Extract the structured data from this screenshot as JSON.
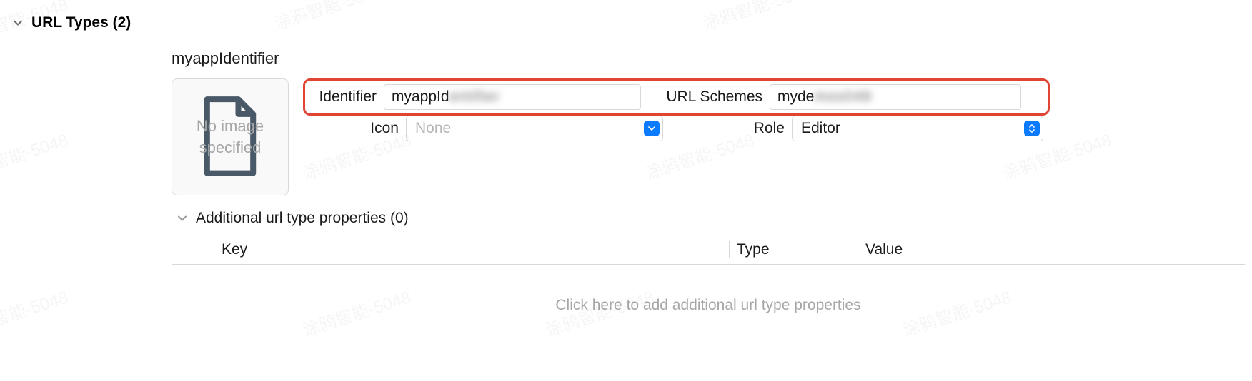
{
  "section": {
    "title": "URL Types (2)"
  },
  "urlType": {
    "name": "myappIdentifier",
    "imageWell": "No image specified",
    "fields": {
      "identifier_label": "Identifier",
      "identifier_visible": "myappId",
      "identifier_hidden": "entifier",
      "urlschemes_label": "URL Schemes",
      "urlschemes_visible": "myde",
      "urlschemes_hidden": "mos048",
      "icon_label": "Icon",
      "icon_placeholder": "None",
      "role_label": "Role",
      "role_value": "Editor"
    }
  },
  "additional": {
    "title": "Additional url type properties (0)",
    "columns": {
      "key": "Key",
      "type": "Type",
      "value": "Value"
    },
    "empty_text": "Click here to add additional url type properties"
  },
  "watermark_text": "涂鸦智能-5048"
}
